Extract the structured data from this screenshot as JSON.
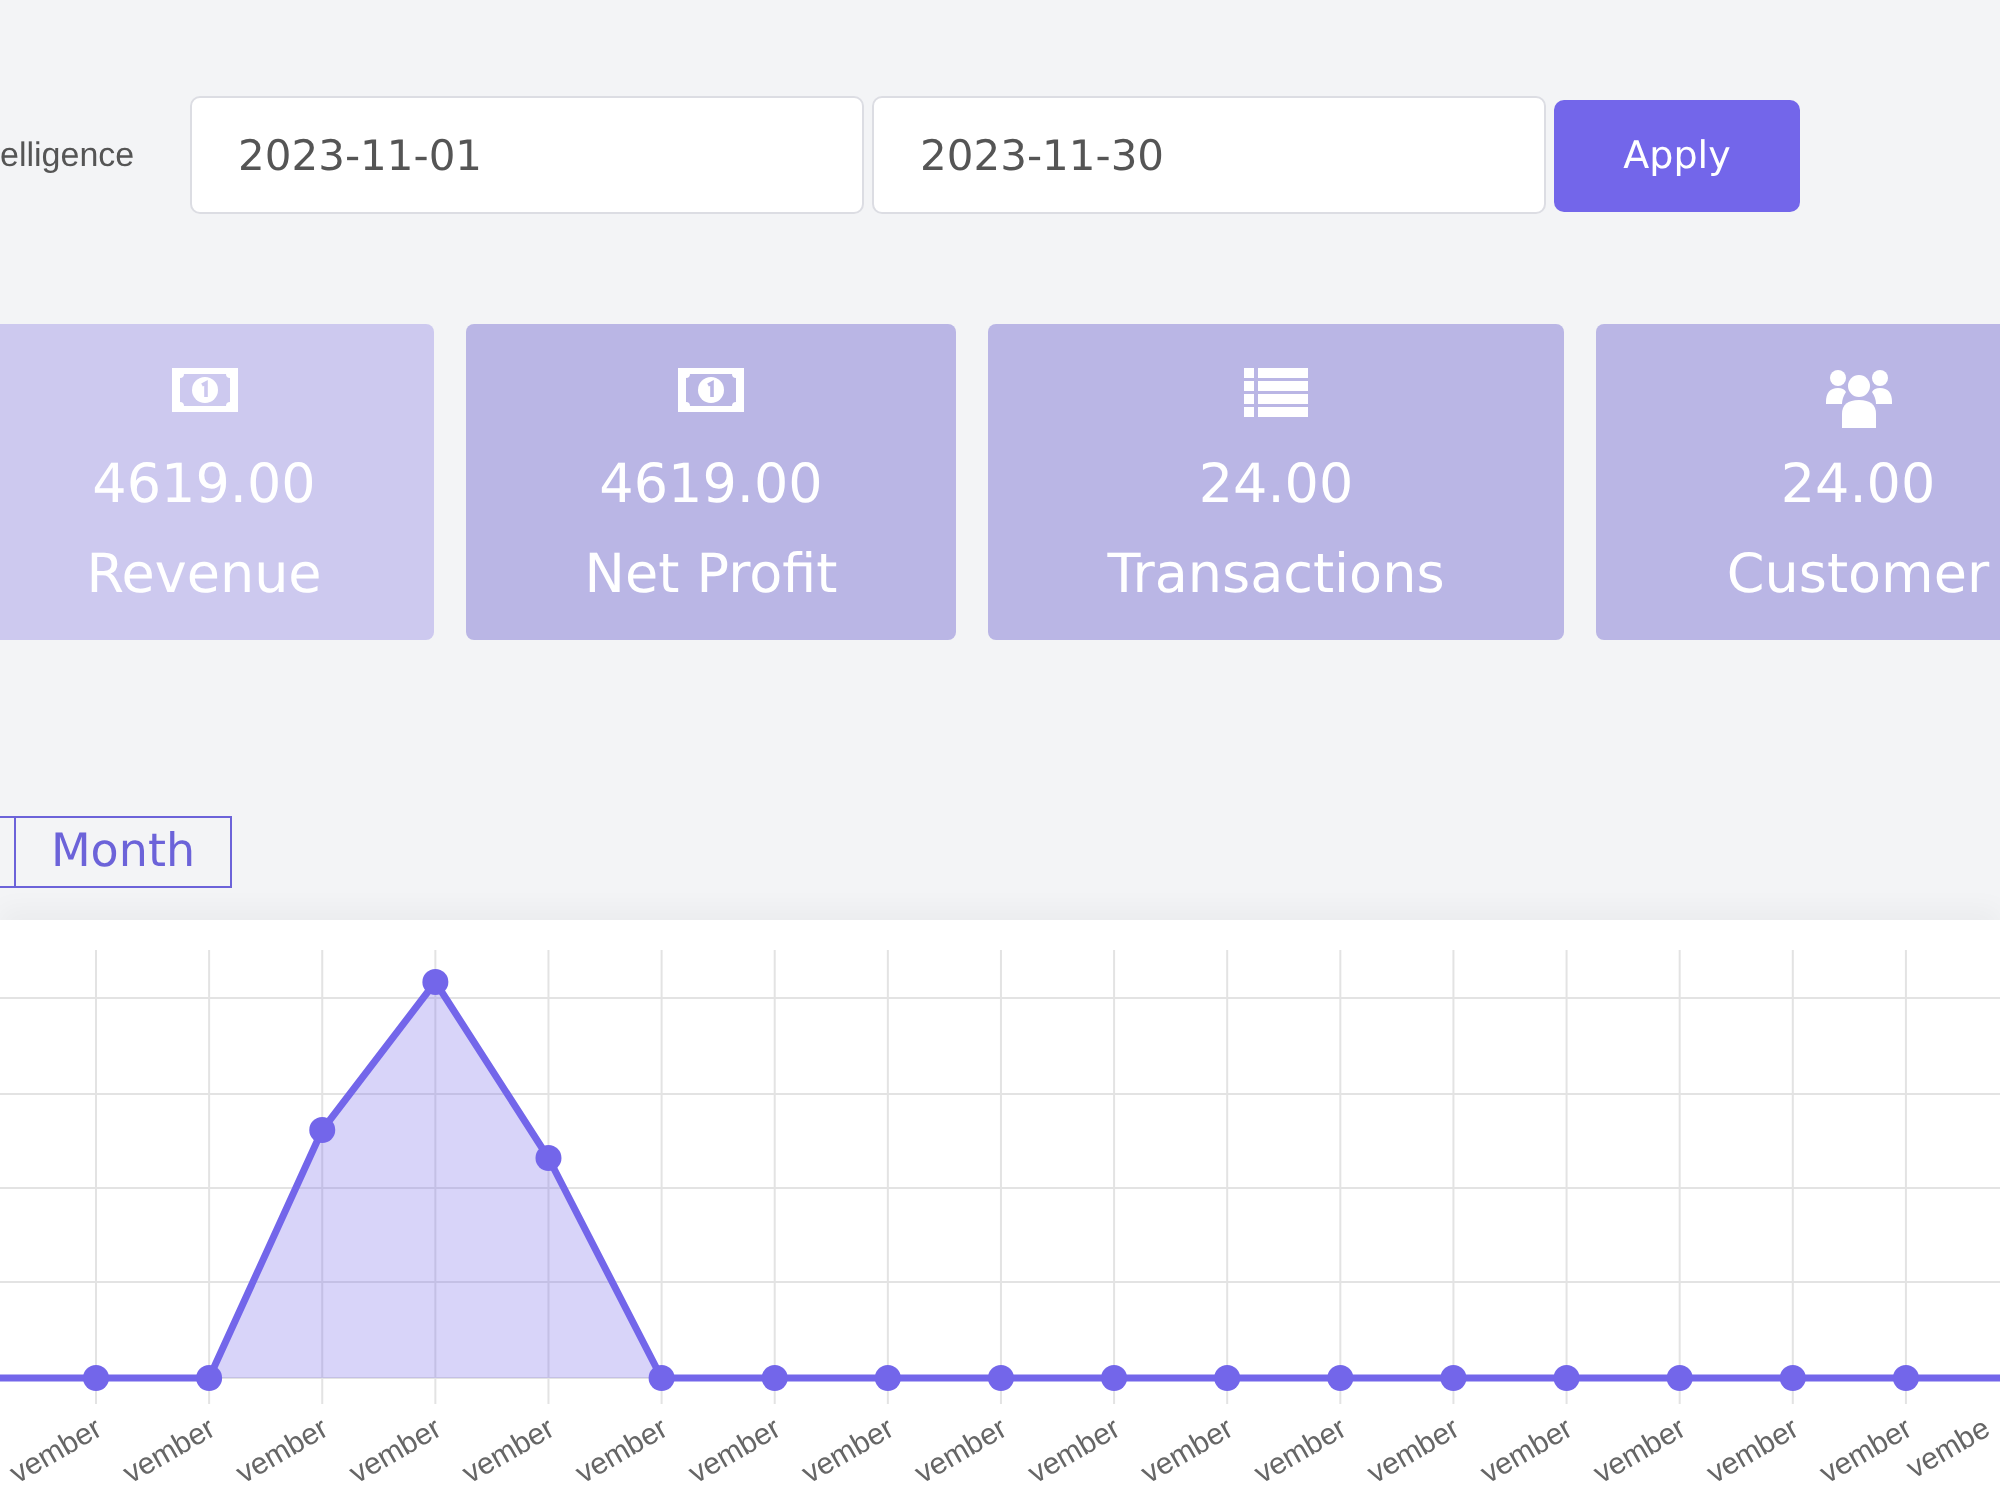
{
  "header": {
    "title": "elligence",
    "start_date": {
      "value": "2023-11-01"
    },
    "end_date": {
      "value": "2023-11-30"
    },
    "apply_button": "Apply"
  },
  "stat_cards": [
    {
      "kind": "banknote",
      "value": "4619.00",
      "label": "Revenue",
      "color": "#cdc9ef"
    },
    {
      "kind": "banknote",
      "value": "4619.00",
      "label": "Net Profit",
      "color": "#bab6e5"
    },
    {
      "kind": "list",
      "value": "24.00",
      "label": "Transactions",
      "color": "#bab6e5"
    },
    {
      "kind": "users",
      "value": "24.00",
      "label": "Customer",
      "color": "#bab6e5"
    }
  ],
  "period_buttons": [
    {
      "kind": "partial"
    },
    {
      "kind": "full",
      "label": "Month"
    }
  ],
  "chart": {
    "x_labels": [
      "vember",
      "vember",
      "vember",
      "vember",
      "vember",
      "vember",
      "vember",
      "vember",
      "vember",
      "vember",
      "vember",
      "vember",
      "vember",
      "vember",
      "vember",
      "vember",
      "vember",
      "vembe"
    ]
  }
}
